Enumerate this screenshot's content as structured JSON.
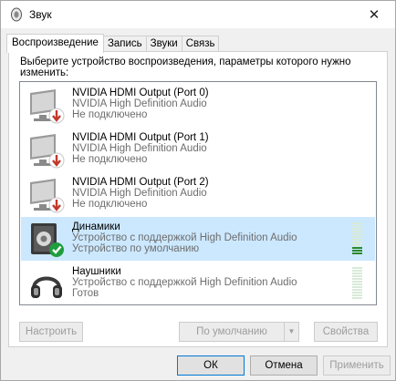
{
  "window": {
    "title": "Звук",
    "close_glyph": "✕"
  },
  "tabs": [
    {
      "label": "Воспроизведение",
      "active": true
    },
    {
      "label": "Запись",
      "active": false
    },
    {
      "label": "Звуки",
      "active": false
    },
    {
      "label": "Связь",
      "active": false
    }
  ],
  "instructions": "Выберите устройство воспроизведения, параметры которого нужно изменить:",
  "devices": [
    {
      "name": "NVIDIA HDMI Output (Port 0)",
      "description": "NVIDIA High Definition Audio",
      "status": "Не подключено",
      "icon": "monitor-disconnected-icon",
      "selected": false
    },
    {
      "name": "NVIDIA HDMI Output (Port 1)",
      "description": "NVIDIA High Definition Audio",
      "status": "Не подключено",
      "icon": "monitor-disconnected-icon",
      "selected": false
    },
    {
      "name": "NVIDIA HDMI Output (Port 2)",
      "description": "NVIDIA High Definition Audio",
      "status": "Не подключено",
      "icon": "monitor-disconnected-icon",
      "selected": false
    },
    {
      "name": "Динамики",
      "description": "Устройство с поддержкой High Definition Audio",
      "status": "Устройство по умолчанию",
      "icon": "speaker-default-icon",
      "selected": true,
      "meter_level": 0.25
    },
    {
      "name": "Наушники",
      "description": "Устройство с поддержкой High Definition Audio",
      "status": "Готов",
      "icon": "headphones-icon",
      "selected": false,
      "meter_level": 0
    }
  ],
  "buttons": {
    "configure": "Настроить",
    "set_default": "По умолчанию",
    "properties": "Свойства",
    "ok": "ОК",
    "cancel": "Отмена",
    "apply": "Применить"
  },
  "colors": {
    "selection": "#cce8ff",
    "meter_on": "#2a8a2a",
    "accent": "#0078d7"
  }
}
